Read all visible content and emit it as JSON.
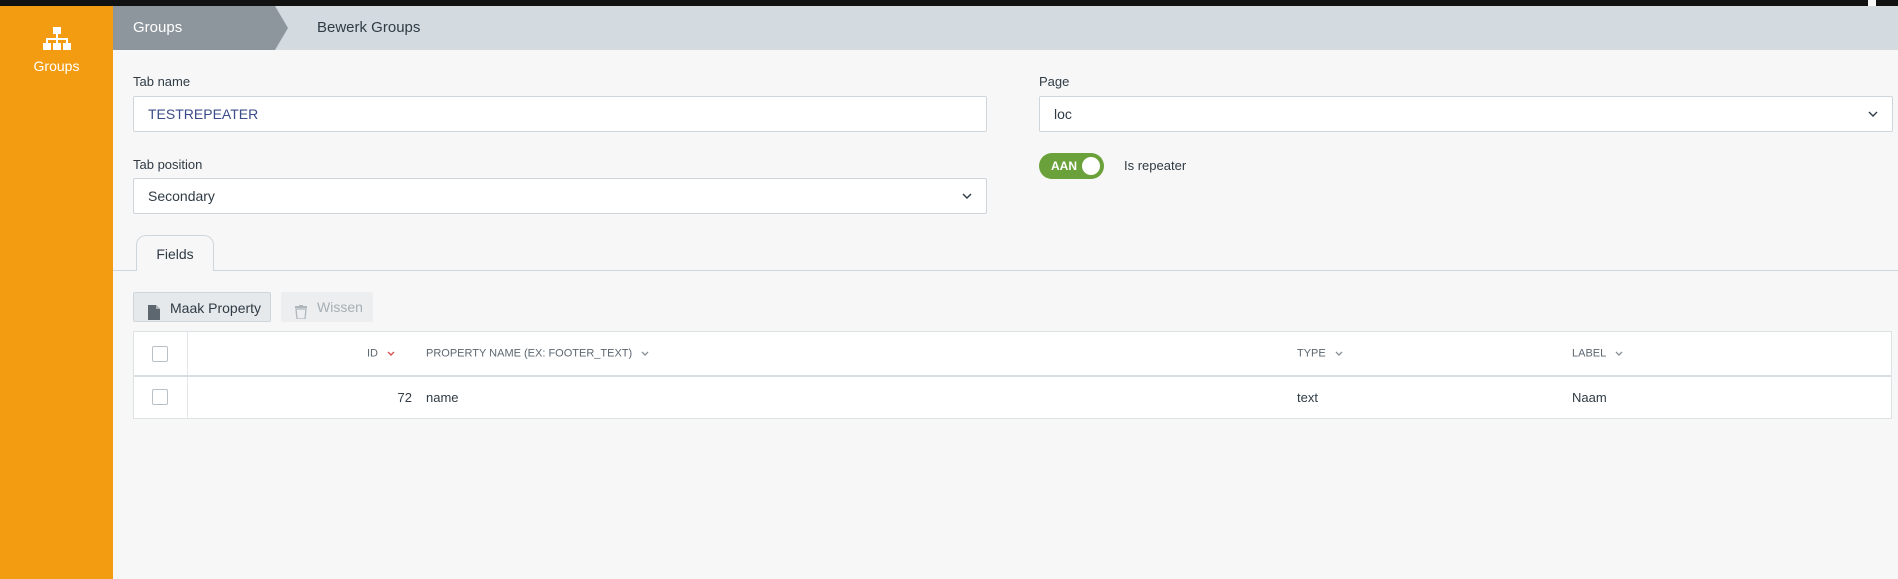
{
  "sidebar": {
    "items": [
      {
        "label": "Groups",
        "icon": "sitemap-icon"
      }
    ],
    "color": "#f39c12"
  },
  "breadcrumb": {
    "items": [
      "Groups",
      "Bewerk Groups"
    ]
  },
  "form": {
    "tab_name": {
      "label": "Tab name",
      "value": "TESTREPEATER"
    },
    "tab_position": {
      "label": "Tab position",
      "value": "Secondary"
    },
    "page": {
      "label": "Page",
      "value": "loc"
    },
    "repeater": {
      "toggle_text": "AAN",
      "label": "Is repeater",
      "on": true,
      "color": "#6aa13b"
    }
  },
  "tabs": [
    {
      "label": "Fields",
      "active": true
    }
  ],
  "actions": {
    "create": "Maak Property",
    "delete": "Wissen"
  },
  "table": {
    "columns": [
      "ID",
      "PROPERTY NAME (EX: FOOTER_TEXT)",
      "TYPE",
      "LABEL"
    ],
    "rows": [
      {
        "id": "72",
        "name": "name",
        "type": "text",
        "label": "Naam"
      }
    ]
  }
}
